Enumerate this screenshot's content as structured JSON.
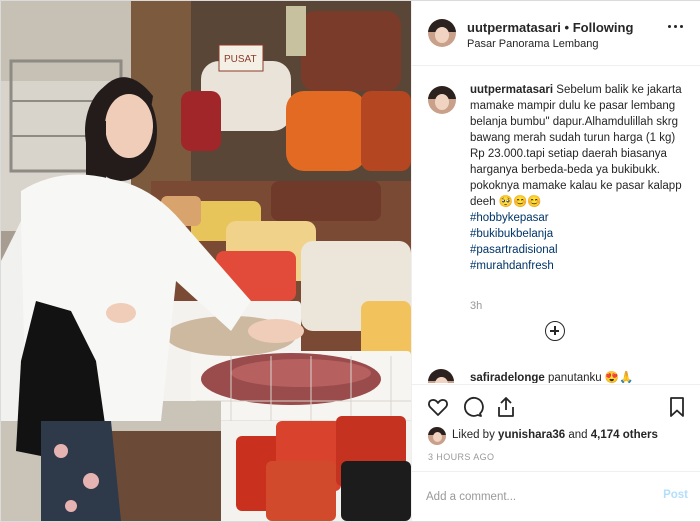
{
  "post": {
    "username": "uutpermatasari",
    "separator": "•",
    "follow_status": "Following",
    "location": "Pasar Panorama Lembang"
  },
  "caption": {
    "username": "uutpermatasari",
    "text": "Sebelum balik ke jakarta mamake mampir dulu ke pasar lembang belanja bumbu\" dapur.Alhamdulillah skrg bawang merah sudah turun harga (1 kg) Rp 23.000.tapi setiap daerah biasanya harganya berbeda-beda ya bukibukk. pokoknya mamake kalau ke pasar kalapp deeh 🥺😊😊",
    "hashtags": [
      "#hobbykepasar",
      "#bukibukbelanja",
      "#pasartradisional",
      "#murahdanfresh"
    ],
    "time": "3h"
  },
  "comment": {
    "username": "safiradelonge",
    "text": "panutanku 😍🙏"
  },
  "actions": {
    "icons": [
      "heart-icon",
      "comment-icon",
      "share-icon",
      "bookmark-icon"
    ]
  },
  "likes": {
    "prefix": "Liked by",
    "user": "yunishara36",
    "middle": "and",
    "others": "4,174 others"
  },
  "post_time": "3 HOURS AGO",
  "add_comment": {
    "placeholder": "Add a comment...",
    "post_label": "Post"
  },
  "photo": {
    "sign_text": "PUSAT"
  },
  "colors": {
    "link": "#003569",
    "muted": "#999999",
    "post_disabled": "#b2dffc"
  }
}
